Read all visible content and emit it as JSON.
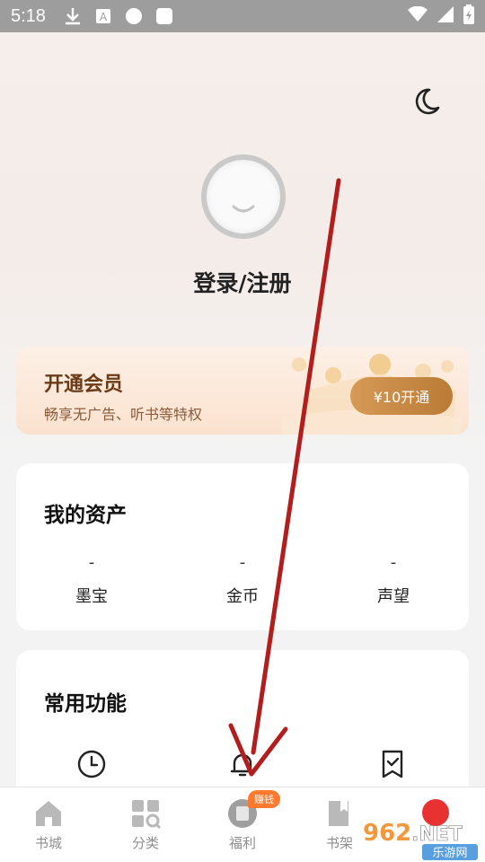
{
  "status_bar": {
    "time": "5:18"
  },
  "profile": {
    "login_label": "登录/注册"
  },
  "vip": {
    "title": "开通会员",
    "subtitle": "畅享无广告、听书等特权",
    "button_label": "¥10开通"
  },
  "assets": {
    "title": "我的资产",
    "items": [
      {
        "value": "-",
        "label": "墨宝"
      },
      {
        "value": "-",
        "label": "金币"
      },
      {
        "value": "-",
        "label": "声望"
      }
    ]
  },
  "functions": {
    "title": "常用功能"
  },
  "bottom_nav": {
    "items": [
      {
        "label": "书城"
      },
      {
        "label": "分类"
      },
      {
        "label": "福利"
      },
      {
        "label": "书架"
      }
    ],
    "badge": "赚钱"
  },
  "watermark": {
    "text": "962.NET",
    "subtext": "乐游网"
  },
  "colors": {
    "accent": "#b97b35",
    "arrow": "#b21e1e"
  }
}
